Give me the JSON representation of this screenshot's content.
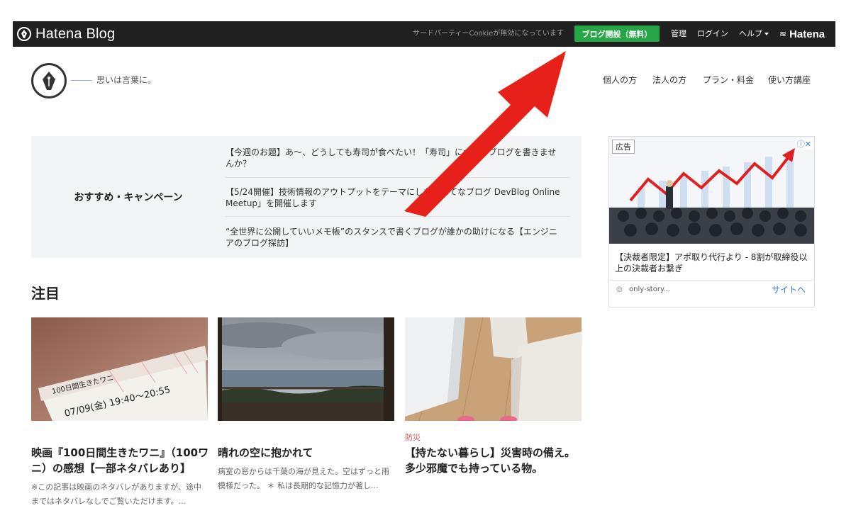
{
  "topbar": {
    "brand": "Hatena Blog",
    "cookie_notice": "サードパーティーCookieが無効になっています",
    "open_blog_button": "ブログ開設（無料）",
    "admin": "管理",
    "login": "ログイン",
    "help": "ヘルプ",
    "hatena": "Hatena"
  },
  "header": {
    "tagline": "思いは言葉に。",
    "nav": [
      "個人の方",
      "法人の方",
      "プラン・料金",
      "使い方講座"
    ]
  },
  "campaign": {
    "label": "おすすめ・キャンペーン",
    "items": [
      "【今週のお題】あ〜、どうしても寿司が食べたい！「寿司」についてブログを書きませんか？",
      "【5/24開催】技術情報のアウトプットをテーマにした「はてなブログ DevBlog Online Meetup」を開催します",
      "“全世界に公開していいメモ帳”のスタンスで書くブログが誰かの助けになる【エンジニアのブログ探訪】"
    ]
  },
  "featured": {
    "title": "注目",
    "cards": [
      {
        "category": "",
        "title": "映画『100日間生きたワニ』（100ワニ）の感想【一部ネタバレあり】",
        "excerpt": "※この記事は映画のネタバレがありますが、途中まではネタバレなしでご覧いただけます。...",
        "ticket_text": "100日間生きたワニ",
        "ticket_date": "07/09(金)  19:40〜20:55"
      },
      {
        "category": "",
        "title": "晴れの空に抱かれて",
        "excerpt": "病室の窓からは千葉の海が見えた。空はずっと雨模様だった。 ＊ 私は長期的な記憶力が著し..."
      },
      {
        "category": "防災",
        "title": "【持たない暮らし】災害時の備え。多少邪魔でも持っている物。",
        "excerpt": ""
      }
    ]
  },
  "ad": {
    "badge": "広告",
    "controls": "ⓘ✕",
    "text": "【決裁者限定】アポ取り代行より - 8割が取締役以上の決裁者お繋ぎ",
    "source": "only-story...",
    "cta": "サイトへ"
  },
  "colors": {
    "topbar_bg": "#202020",
    "open_button": "#27a648",
    "campaign_bg": "#f2f4f6",
    "category": "#d9534f",
    "link_blue": "#2d7ae0",
    "arrow": "#e8201a"
  }
}
